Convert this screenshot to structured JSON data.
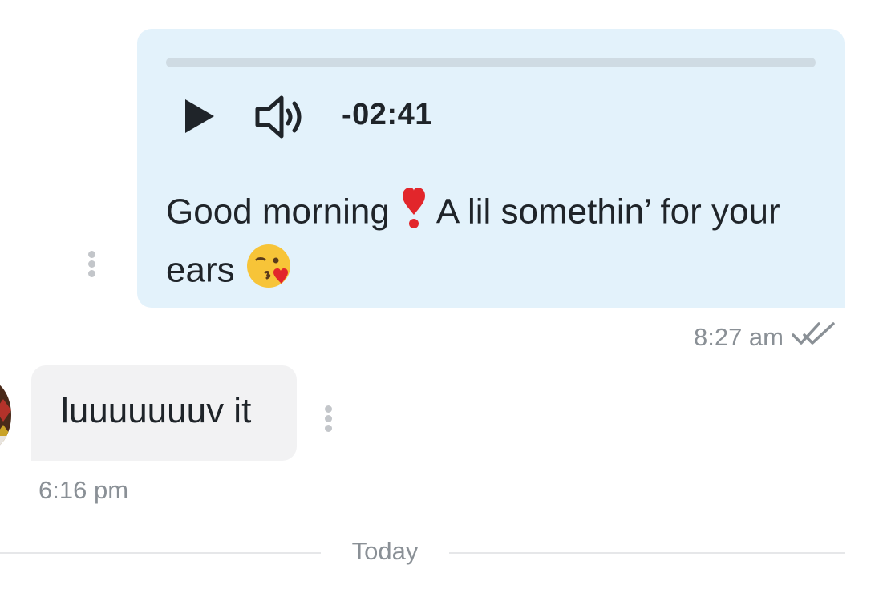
{
  "outgoing_message": {
    "audio": {
      "time_remaining": "-02:41",
      "progress_fraction": 0,
      "play_icon": "play-icon",
      "volume_icon": "volume-icon"
    },
    "text_part1": "Good morning",
    "emoji1": "heavy-exclamation-heart-icon",
    "text_part2": " A lil somethin’ for your ears ",
    "emoji2": "face-blowing-kiss-icon",
    "time": "8:27 am",
    "status_icon": "double-check-icon",
    "bubble_color": "#e3f2fb"
  },
  "incoming_message": {
    "text": "luuuuuuuv it",
    "time": "6:16 pm",
    "bubble_color": "#f2f2f3"
  },
  "date_divider": {
    "label": "Today"
  }
}
